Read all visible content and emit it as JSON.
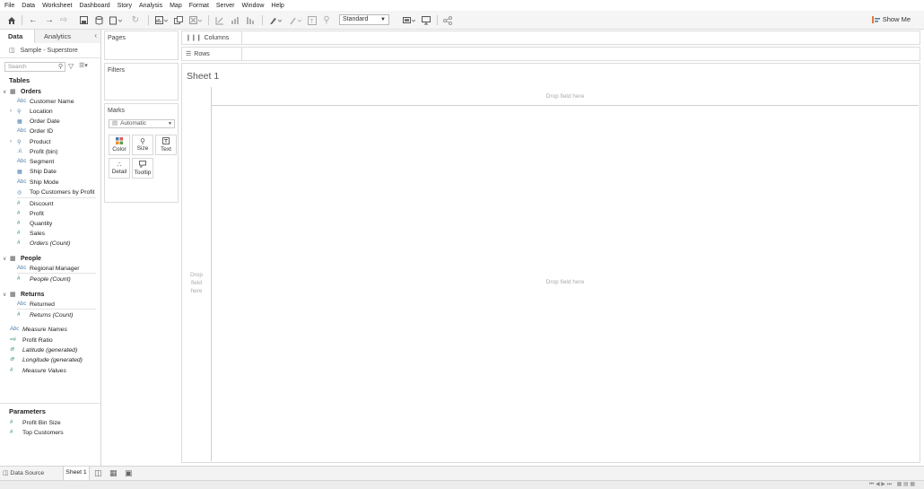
{
  "menu": [
    "File",
    "Data",
    "Worksheet",
    "Dashboard",
    "Story",
    "Analysis",
    "Map",
    "Format",
    "Server",
    "Window",
    "Help"
  ],
  "toolbar": {
    "fit_value": "Standard",
    "show_me_label": "Show Me"
  },
  "data_pane": {
    "tab_data": "Data",
    "tab_analytics": "Analytics",
    "datasource": "Sample - Superstore",
    "search_placeholder": "Search",
    "tables_heading": "Tables",
    "tables": [
      {
        "name": "Orders",
        "fields": [
          {
            "type": "Abc",
            "label": "Customer Name"
          },
          {
            "type": "geo",
            "label": "Location"
          },
          {
            "type": "date",
            "label": "Order Date"
          },
          {
            "type": "Abc",
            "label": "Order ID"
          },
          {
            "type": "geo",
            "label": "Product"
          },
          {
            "type": "bin",
            "label": "Profit (bin)"
          },
          {
            "type": "Abc",
            "label": "Segment"
          },
          {
            "type": "date",
            "label": "Ship Date"
          },
          {
            "type": "Abc",
            "label": "Ship Mode"
          },
          {
            "type": "set",
            "label": "Top Customers by Profit"
          },
          {
            "type": "#",
            "label": "Discount"
          },
          {
            "type": "#",
            "label": "Profit"
          },
          {
            "type": "#",
            "label": "Quantity"
          },
          {
            "type": "#",
            "label": "Sales"
          },
          {
            "type": "#",
            "label": "Orders (Count)"
          }
        ]
      },
      {
        "name": "People",
        "fields": [
          {
            "type": "Abc",
            "label": "Regional Manager"
          },
          {
            "type": "#",
            "label": "People (Count)"
          }
        ]
      },
      {
        "name": "Returns",
        "fields": [
          {
            "type": "Abc",
            "label": "Returned"
          },
          {
            "type": "#",
            "label": "Returns (Count)"
          }
        ]
      }
    ],
    "other_fields": [
      {
        "type": "Abc",
        "label": "Measure Names"
      },
      {
        "type": "=#",
        "label": "Profit Ratio"
      },
      {
        "type": "globe",
        "label": "Latitude (generated)"
      },
      {
        "type": "globe",
        "label": "Longitude (generated)"
      },
      {
        "type": "#",
        "label": "Measure Values"
      }
    ],
    "parameters_heading": "Parameters",
    "parameters": [
      {
        "type": "#",
        "label": "Profit Bin Size"
      },
      {
        "type": "#",
        "label": "Top Customers"
      }
    ]
  },
  "cards": {
    "pages": "Pages",
    "filters": "Filters",
    "marks": "Marks",
    "marks_type": "Automatic",
    "mark_buttons": [
      "Color",
      "Size",
      "Text",
      "Detail",
      "Tooltip"
    ]
  },
  "shelves": {
    "columns": "Columns",
    "rows": "Rows"
  },
  "view": {
    "sheet_title": "Sheet 1",
    "drop_columns": "Drop field here",
    "drop_rows_1": "Drop",
    "drop_rows_2": "field",
    "drop_rows_3": "here",
    "drop_body": "Drop field here"
  },
  "bottom": {
    "data_source_tab": "Data Source",
    "sheet_tab": "Sheet 1"
  }
}
